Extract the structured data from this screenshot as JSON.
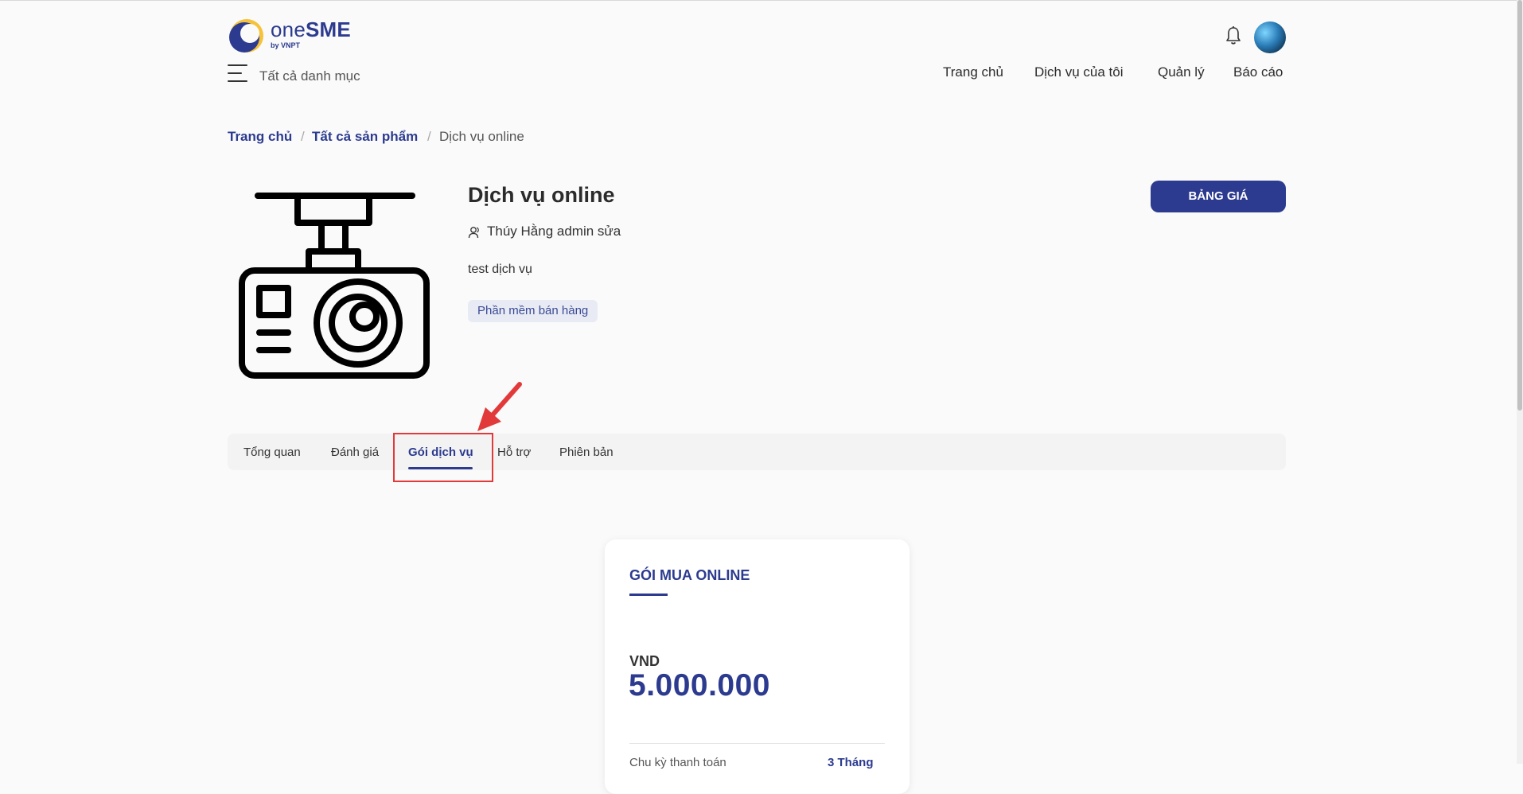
{
  "header": {
    "logo_one": "one",
    "logo_sme": "SME",
    "logo_sub": "by VNPT",
    "menu_label": "Tất cả danh mục",
    "nav": [
      "Trang chủ",
      "Dịch vụ của tôi",
      "Quản lý",
      "Báo cáo"
    ],
    "icons": {
      "notifications": "bell-icon",
      "menu": "hamburger-icon"
    }
  },
  "breadcrumb": {
    "items": [
      "Trang chủ",
      "Tất cả sản phẩm",
      "Dịch vụ online"
    ],
    "separator": "/"
  },
  "product": {
    "title": "Dịch vụ online",
    "author": "Thúy Hằng admin sửa",
    "description": "test dịch vụ",
    "tag": "Phần mềm bán hàng",
    "price_button": "BẢNG GIÁ",
    "image_icon": "dashcam-icon"
  },
  "tabs": {
    "items": [
      "Tổng quan",
      "Đánh giá",
      "Gói dịch vụ",
      "Hỗ trợ",
      "Phiên bản"
    ],
    "active": "Gói dịch vụ"
  },
  "plan_card": {
    "title": "GÓI MUA ONLINE",
    "currency": "VND",
    "price": "5.000.000",
    "cycle_label": "Chu kỳ thanh toán",
    "cycle_value": "3 Tháng"
  },
  "colors": {
    "brand": "#2c3b8f",
    "annotation": "#e23a3a",
    "background": "#fafafa"
  }
}
